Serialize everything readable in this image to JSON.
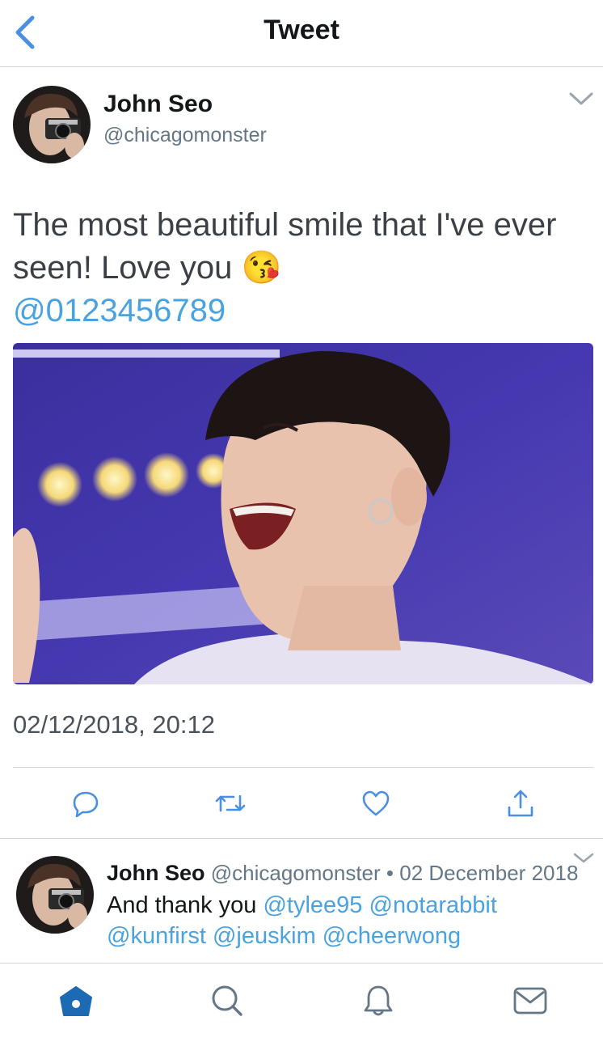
{
  "header": {
    "title": "Tweet",
    "back_icon": "chevron-left-icon",
    "accent": "#4a90e2"
  },
  "tweet": {
    "author_name": "John Seo",
    "author_handle": "@chicagomonster",
    "text": "The most beautiful smile that I've ever seen! Love you",
    "emoji": "😘",
    "mention": "@0123456789",
    "timestamp": "02/12/2018, 20:12",
    "menu_icon": "chevron-down-icon"
  },
  "actions": [
    {
      "name": "reply",
      "icon": "reply-icon"
    },
    {
      "name": "retweet",
      "icon": "retweet-icon"
    },
    {
      "name": "like",
      "icon": "heart-icon"
    },
    {
      "name": "share",
      "icon": "share-icon"
    }
  ],
  "reply": {
    "author_name": "John Seo",
    "author_handle": "@chicagomonster",
    "separator": "•",
    "date": "02 December 2018",
    "text_prefix": "And thank you",
    "mentions_line1": [
      "@tylee95",
      "@notarabbit"
    ],
    "mentions_line2": [
      "@kunfirst",
      "@jeuskim",
      "@cheerwong"
    ]
  },
  "tabbar": [
    {
      "name": "home",
      "icon": "home-icon",
      "active": true
    },
    {
      "name": "search",
      "icon": "search-icon",
      "active": false
    },
    {
      "name": "notifications",
      "icon": "bell-icon",
      "active": false
    },
    {
      "name": "messages",
      "icon": "mail-icon",
      "active": false
    }
  ],
  "colors": {
    "link": "#4aa3df",
    "active_tab": "#1d6ab4",
    "icon_gray": "#657786"
  }
}
